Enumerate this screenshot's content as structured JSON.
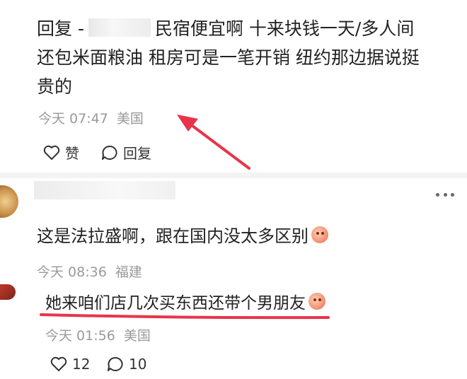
{
  "reply1": {
    "reply_prefix": "回复 -",
    "text_line1": "民宿便宜啊 十来块钱一天/多人间",
    "text_line2": "还包米面粮油 租房可是一笔开销 纽约那边据说挺",
    "text_line3": "贵的",
    "time": "今天 07:47",
    "location": "美国",
    "like_label": "赞",
    "reply_label": "回复"
  },
  "comment2": {
    "text": "这是法拉盛啊，跟在国内没太多区别",
    "time": "今天 08:36",
    "location": "福建"
  },
  "comment3": {
    "text": "她来咱们店几次买东西还带个男朋友",
    "time": "今天 01:56",
    "location": "美国",
    "likes": "12",
    "replies": "10"
  },
  "colors": {
    "annotation_red": "#e8344a",
    "meta_gray": "#9a9a9a",
    "divider": "#f3f3f3"
  }
}
